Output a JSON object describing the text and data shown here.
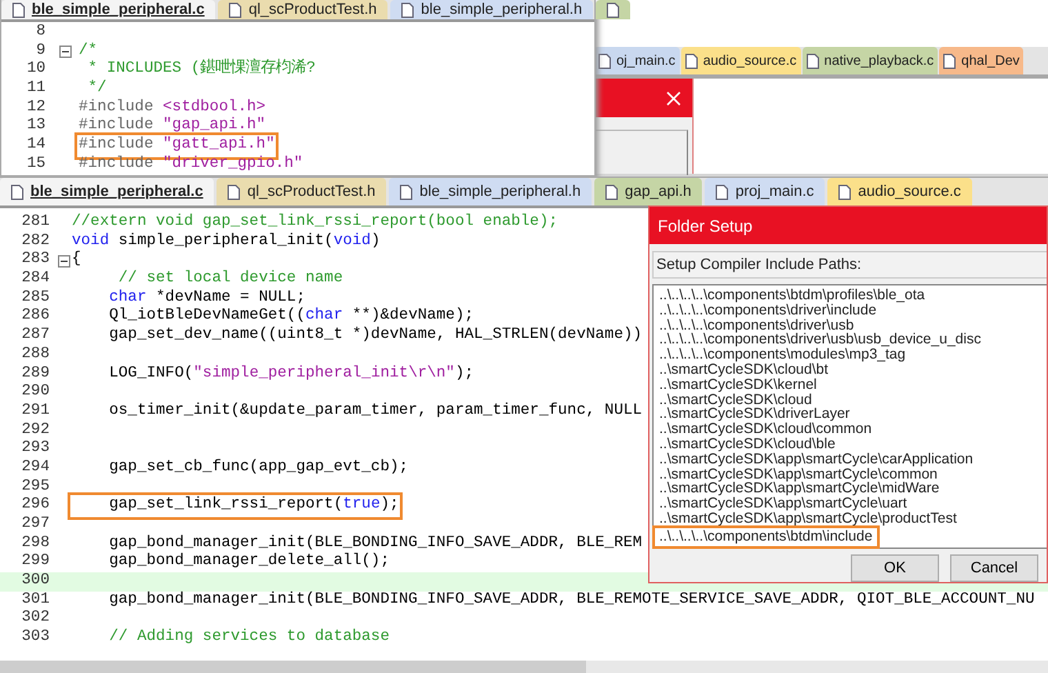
{
  "back_editor": {
    "tabs": [
      {
        "label": "oj_main.c",
        "color": "#c9d8ef"
      },
      {
        "label": "audio_source.c",
        "color": "#fbe08a"
      },
      {
        "label": "native_playback.c",
        "color": "#c5d5a5"
      },
      {
        "label": "qhal_Dev",
        "color": "#f7b98a"
      }
    ]
  },
  "top_editor": {
    "tabs": [
      {
        "label": "ble_simple_peripheral.c",
        "selected": true,
        "color": "#f4f4f4"
      },
      {
        "label": "ql_scProductTest.h",
        "selected": false,
        "color": "#eadcae"
      },
      {
        "label": "ble_simple_peripheral.h",
        "selected": false,
        "color": "#cfdcf2"
      },
      {
        "selected": false,
        "color": "#c5d5a5"
      }
    ],
    "lines": [
      {
        "number": "8"
      },
      {
        "number": "9",
        "fold": true,
        "segments": [
          {
            "kind": "comment",
            "text": "/*"
          }
        ]
      },
      {
        "number": "10",
        "segments": [
          {
            "kind": "comment",
            "text": " * INCLUDES (鍖呭惈澶存枃浠?"
          }
        ]
      },
      {
        "number": "11",
        "segments": [
          {
            "kind": "comment",
            "text": " */"
          }
        ]
      },
      {
        "number": "12",
        "segments": [
          {
            "kind": "directive",
            "text": "#include "
          },
          {
            "kind": "string",
            "text": "<stdbool.h>"
          }
        ]
      },
      {
        "number": "13",
        "segments": [
          {
            "kind": "directive",
            "text": "#include "
          },
          {
            "kind": "string",
            "text": "\"gap_api.h\""
          }
        ]
      },
      {
        "number": "14",
        "annotated": true,
        "segments": [
          {
            "kind": "directive",
            "text": "#include "
          },
          {
            "kind": "string",
            "text": "\"gatt_api.h\""
          }
        ]
      },
      {
        "number": "15",
        "segments": [
          {
            "kind": "directive",
            "text": "#include "
          },
          {
            "kind": "string",
            "text": "\"driver_gpio.h\""
          }
        ]
      }
    ]
  },
  "main_editor": {
    "tabs": [
      {
        "label": "ble_simple_peripheral.c",
        "selected": true,
        "color": "#f4f4f4"
      },
      {
        "label": "ql_scProductTest.h",
        "selected": false,
        "color": "#eadcae"
      },
      {
        "label": "ble_simple_peripheral.h",
        "selected": false,
        "color": "#cfdcf2"
      },
      {
        "label": "gap_api.h",
        "selected": false,
        "color": "#c5d5a5"
      },
      {
        "label": "proj_main.c",
        "selected": false,
        "color": "#cfdcf2"
      },
      {
        "label": "audio_source.c",
        "selected": false,
        "color": "#fbe08a"
      }
    ],
    "lines": [
      {
        "number": "281",
        "segments": [
          {
            "kind": "comment",
            "text": "//extern void gap_set_link_rssi_report(bool enable);"
          }
        ]
      },
      {
        "number": "282",
        "segments": [
          {
            "kind": "keyword",
            "text": "void"
          },
          {
            "kind": "plain",
            "text": " simple_peripheral_init("
          },
          {
            "kind": "keyword",
            "text": "void"
          },
          {
            "kind": "plain",
            "text": ")"
          }
        ]
      },
      {
        "number": "283",
        "fold": true,
        "segments": [
          {
            "kind": "plain",
            "text": "{"
          }
        ]
      },
      {
        "number": "284",
        "segments": [
          {
            "kind": "comment",
            "text": "     // set local device name"
          }
        ]
      },
      {
        "number": "285",
        "segments": [
          {
            "kind": "keyword",
            "text": "    char"
          },
          {
            "kind": "plain",
            "text": " *devName = NULL;"
          }
        ]
      },
      {
        "number": "286",
        "segments": [
          {
            "kind": "plain",
            "text": "    Ql_iotBleDevNameGet(("
          },
          {
            "kind": "keyword",
            "text": "char"
          },
          {
            "kind": "plain",
            "text": " **)&devName);"
          }
        ]
      },
      {
        "number": "287",
        "segments": [
          {
            "kind": "plain",
            "text": "    gap_set_dev_name((uint8_t *)devName, HAL_STRLEN(devName))"
          }
        ]
      },
      {
        "number": "288"
      },
      {
        "number": "289",
        "segments": [
          {
            "kind": "plain",
            "text": "    LOG_INFO("
          },
          {
            "kind": "string",
            "text": "\"simple_peripheral_init\\r\\n\""
          },
          {
            "kind": "plain",
            "text": ");"
          }
        ]
      },
      {
        "number": "290"
      },
      {
        "number": "291",
        "segments": [
          {
            "kind": "plain",
            "text": "    os_timer_init(&update_param_timer, param_timer_func, NULL"
          }
        ]
      },
      {
        "number": "292"
      },
      {
        "number": "293"
      },
      {
        "number": "294",
        "segments": [
          {
            "kind": "plain",
            "text": "    gap_set_cb_func(app_gap_evt_cb);"
          }
        ]
      },
      {
        "number": "295"
      },
      {
        "number": "296",
        "annotated": true,
        "segments": [
          {
            "kind": "plain",
            "text": "    gap_set_link_rssi_report("
          },
          {
            "kind": "keyword",
            "text": "true"
          },
          {
            "kind": "plain",
            "text": ");"
          }
        ]
      },
      {
        "number": "297"
      },
      {
        "number": "298",
        "segments": [
          {
            "kind": "plain",
            "text": "    gap_bond_manager_init(BLE_BONDING_INFO_SAVE_ADDR, BLE_REM"
          }
        ]
      },
      {
        "number": "299",
        "segments": [
          {
            "kind": "plain",
            "text": "    gap_bond_manager_delete_all();"
          }
        ]
      },
      {
        "number": "300",
        "highlighted": true
      },
      {
        "number": "301",
        "segments": [
          {
            "kind": "plain",
            "text": "    gap_bond_manager_init(BLE_BONDING_INFO_SAVE_ADDR, BLE_REMOTE_SERVICE_SAVE_ADDR, QIOT_BLE_ACCOUNT_NU"
          }
        ]
      },
      {
        "number": "302"
      },
      {
        "number": "303",
        "segments": [
          {
            "kind": "comment",
            "text": "    // Adding services to database"
          }
        ]
      }
    ]
  },
  "folder_setup": {
    "title": "Folder Setup",
    "label": "Setup Compiler Include Paths:",
    "paths": [
      {
        "text": "..\\..\\..\\..\\components\\btdm\\profiles\\ble_ota",
        "annotated": false
      },
      {
        "text": "..\\..\\..\\..\\components\\driver\\include",
        "annotated": false
      },
      {
        "text": "..\\..\\..\\..\\components\\driver\\usb",
        "annotated": false
      },
      {
        "text": "..\\..\\..\\..\\components\\driver\\usb\\usb_device_u_disc",
        "annotated": false
      },
      {
        "text": "..\\..\\..\\..\\components\\modules\\mp3_tag",
        "annotated": false
      },
      {
        "text": "..\\smartCycleSDK\\cloud\\bt",
        "annotated": false
      },
      {
        "text": "..\\smartCycleSDK\\kernel",
        "annotated": false
      },
      {
        "text": "..\\smartCycleSDK\\cloud",
        "annotated": false
      },
      {
        "text": "..\\smartCycleSDK\\driverLayer",
        "annotated": false
      },
      {
        "text": "..\\smartCycleSDK\\cloud\\common",
        "annotated": false
      },
      {
        "text": "..\\smartCycleSDK\\cloud\\ble",
        "annotated": false
      },
      {
        "text": "..\\smartCycleSDK\\app\\smartCycle\\carApplication",
        "annotated": false
      },
      {
        "text": "..\\smartCycleSDK\\app\\smartCycle\\common",
        "annotated": false
      },
      {
        "text": "..\\smartCycleSDK\\app\\smartCycle\\midWare",
        "annotated": false
      },
      {
        "text": "..\\smartCycleSDK\\app\\smartCycle\\uart",
        "annotated": false
      },
      {
        "text": "..\\smartCycleSDK\\app\\smartCycle\\productTest",
        "annotated": false
      },
      {
        "text": "..\\..\\..\\..\\components\\btdm\\include",
        "annotated": true
      }
    ],
    "buttons": [
      "OK",
      "Cancel"
    ]
  }
}
